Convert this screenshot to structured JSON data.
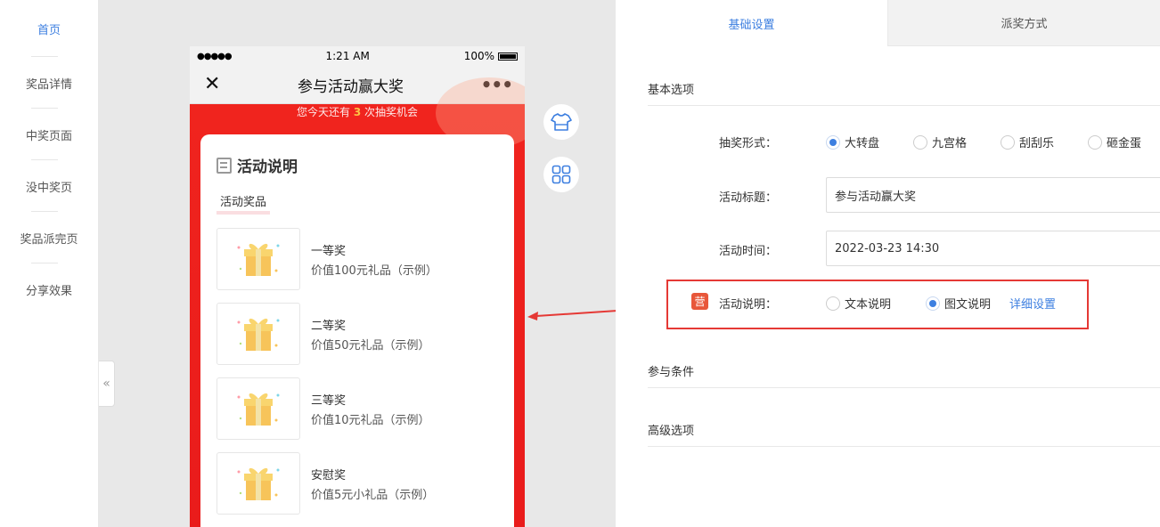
{
  "leftnav": {
    "items": [
      {
        "label": "首页",
        "active": true
      },
      {
        "label": "奖品详情"
      },
      {
        "label": "中奖页面"
      },
      {
        "label": "没中奖页"
      },
      {
        "label": "奖品派完页"
      },
      {
        "label": "分享效果"
      }
    ],
    "collapse_glyph": "«"
  },
  "phone": {
    "status": {
      "signal": "●●●●●",
      "time": "1:21 AM",
      "battery": "100%"
    },
    "nav": {
      "close": "✕",
      "title": "参与活动赢大奖",
      "more": "•••"
    },
    "chance": {
      "before": "您今天还有",
      "count": "3",
      "after": "次抽奖机会"
    },
    "card": {
      "title": "活动说明",
      "prize_tag": "活动奖品",
      "prizes": [
        {
          "name": "一等奖",
          "desc": "价值100元礼品（示例）"
        },
        {
          "name": "二等奖",
          "desc": "价值50元礼品（示例）"
        },
        {
          "name": "三等奖",
          "desc": "价值10元礼品（示例）"
        },
        {
          "name": "安慰奖",
          "desc": "价值5元小礼品（示例）"
        }
      ]
    }
  },
  "tools": [
    "shirt-icon",
    "grid-icon"
  ],
  "panel": {
    "tabs": [
      {
        "label": "基础设置",
        "active": true
      },
      {
        "label": "派奖方式"
      }
    ],
    "sections": {
      "basic": "基本选项",
      "join": "参与条件",
      "advanced": "高级选项"
    },
    "form": {
      "lottery_type": {
        "label": "抽奖形式：",
        "options": [
          "大转盘",
          "九宫格",
          "刮刮乐",
          "砸金蛋"
        ],
        "selected": "大转盘"
      },
      "title": {
        "label": "活动标题：",
        "value": "参与活动赢大奖"
      },
      "time": {
        "label": "活动时间：",
        "value": "2022-03-23 14:30"
      },
      "description": {
        "badge": "营",
        "label": "活动说明：",
        "options": [
          "文本说明",
          "图文说明"
        ],
        "selected": "图文说明",
        "link": "详细设置"
      }
    }
  },
  "colors": {
    "accent": "#3d7fe0",
    "highlight": "#e53935",
    "phone_bg": "#ee2020"
  }
}
